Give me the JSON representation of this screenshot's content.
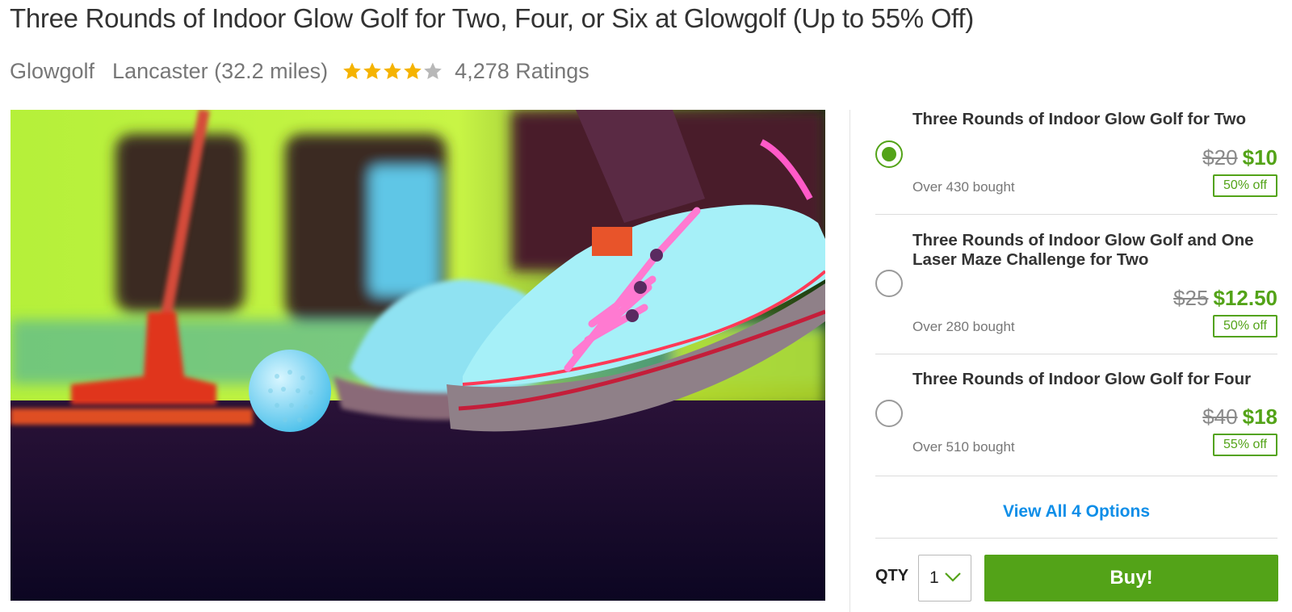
{
  "deal": {
    "title": "Three Rounds of Indoor Glow Golf for Two, Four, or Six at Glowgolf (Up to 55% Off)",
    "merchant": "Glowgolf",
    "location": "Lancaster (32.2 miles)",
    "rating_stars": 4,
    "rating_max": 5,
    "ratings_count": "4,278 Ratings",
    "image_alt": "Glowing golf ball and neon sneakers on a glow golf course"
  },
  "options": [
    {
      "title": "Three Rounds of Indoor Glow Golf for Two",
      "original_price": "$20",
      "price": "$10",
      "discount": "50% off",
      "bought": "Over 430 bought",
      "selected": true
    },
    {
      "title": "Three Rounds of Indoor Glow Golf and One Laser Maze Challenge for Two",
      "original_price": "$25",
      "price": "$12.50",
      "discount": "50% off",
      "bought": "Over 280 bought",
      "selected": false
    },
    {
      "title": "Three Rounds of Indoor Glow Golf for Four",
      "original_price": "$40",
      "price": "$18",
      "discount": "55% off",
      "bought": "Over 510 bought",
      "selected": false
    }
  ],
  "view_all_label": "View All 4 Options",
  "purchase": {
    "qty_label": "QTY",
    "qty_value": "1",
    "buy_label": "Buy!"
  },
  "colors": {
    "accent_green": "#53a318",
    "link_blue": "#0e8ee8",
    "star_gold": "#f5b301"
  }
}
